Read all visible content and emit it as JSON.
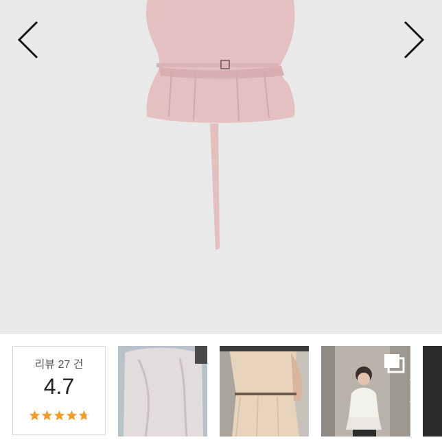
{
  "gallery": {
    "prev_icon": "chevron-left-icon",
    "next_icon": "chevron-right-icon"
  },
  "review": {
    "label": "리뷰 27 건",
    "score": "4.7",
    "rating": 4.7,
    "max": 5,
    "star_color": "#f39c2b"
  },
  "thumbnails": [
    {
      "icon": "photo"
    },
    {
      "icon": "photo"
    },
    {
      "icon": "photo",
      "overlay_icon": "multiple-images-icon"
    }
  ],
  "strip_next_icon": "chevron-right-icon"
}
